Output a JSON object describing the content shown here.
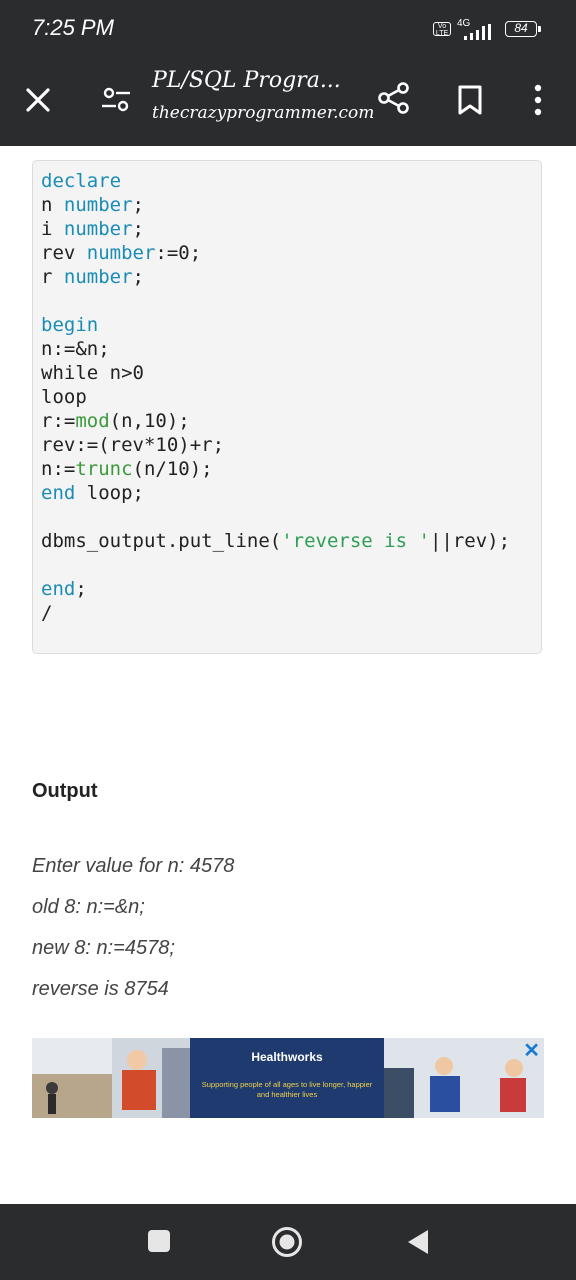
{
  "status_bar": {
    "time": "7:25 PM",
    "volte": "Vo LTE",
    "network": "4G",
    "battery": "84"
  },
  "toolbar": {
    "title": "PL/SQL Progra...",
    "domain": "thecrazyprogrammer.com"
  },
  "code": {
    "lines": [
      "declare",
      "n number;",
      "i number;",
      "rev number:=0;",
      "r number;",
      "",
      "begin",
      "n:=&n;",
      "while n>0",
      "loop",
      "r:=mod(n,10);",
      "rev:=(rev*10)+r;",
      "n:=trunc(n/10);",
      "end loop;",
      "",
      "dbms_output.put_line('reverse is '||rev);",
      "",
      "end;",
      "/"
    ]
  },
  "output": {
    "heading": "Output",
    "lines": [
      "Enter value for n: 4578",
      "old 8: n:=&n;",
      "new 8: n:=4578;",
      "reverse is 8754"
    ]
  },
  "ad": {
    "brand": "Healthworks",
    "tagline": "Supporting people of all ages to live longer, happier and healthier lives",
    "close": "✕"
  },
  "icons": [
    "close-icon",
    "settings-icon",
    "share-icon",
    "bookmark-icon",
    "more-vert-icon",
    "recents-icon",
    "home-icon",
    "back-icon"
  ]
}
